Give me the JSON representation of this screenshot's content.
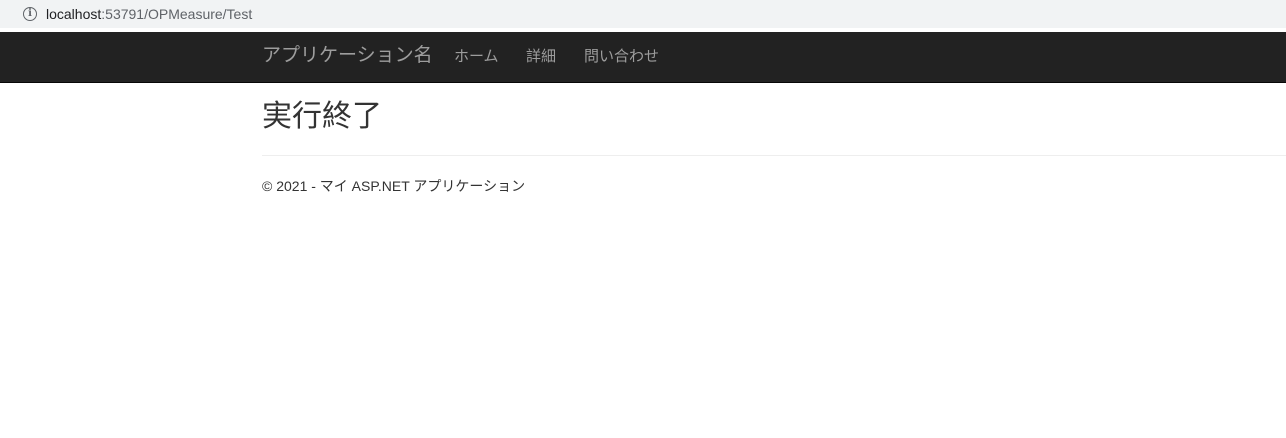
{
  "browser": {
    "url_host": "localhost",
    "url_path": ":53791/OPMeasure/Test",
    "info_icon": "info-icon"
  },
  "navbar": {
    "brand": "アプリケーション名",
    "links": [
      {
        "label": "ホーム"
      },
      {
        "label": "詳細"
      },
      {
        "label": "問い合わせ"
      }
    ],
    "background": "#222222",
    "link_color": "#9d9d9d"
  },
  "main": {
    "heading": "実行終了"
  },
  "footer": {
    "text": "© 2021 - マイ ASP.NET アプリケーション"
  }
}
